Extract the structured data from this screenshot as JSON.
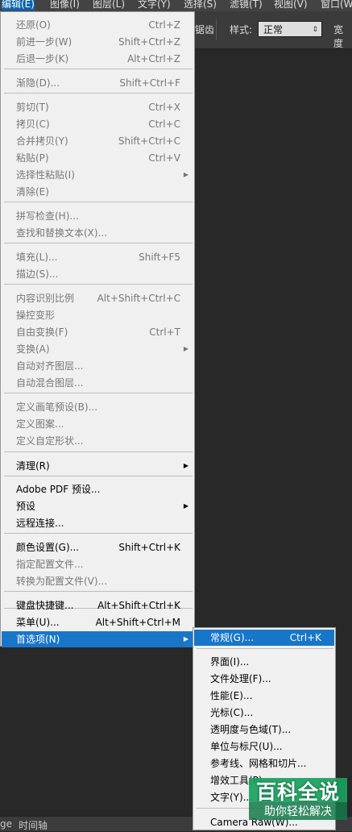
{
  "menubar": {
    "items": [
      "编辑(E)",
      "图像(I)",
      "图层(L)",
      "文字(Y)",
      "选择(S)",
      "滤镜(T)",
      "视图(V)",
      "窗口(W"
    ]
  },
  "options_bar": {
    "partial_label": "锯齿",
    "style_label": "样式:",
    "style_value": "正常",
    "width_label": "宽度"
  },
  "bottom_tabs": [
    "ge",
    "时间轴"
  ],
  "edit_menu": {
    "items": [
      {
        "label": "还原(O)",
        "shortcut": "Ctrl+Z",
        "disabled": true
      },
      {
        "label": "前进一步(W)",
        "shortcut": "Shift+Ctrl+Z",
        "disabled": true
      },
      {
        "label": "后退一步(K)",
        "shortcut": "Alt+Ctrl+Z",
        "disabled": true
      },
      {
        "label": "渐隐(D)...",
        "shortcut": "Shift+Ctrl+F",
        "disabled": true
      },
      {
        "label": "剪切(T)",
        "shortcut": "Ctrl+X",
        "disabled": true
      },
      {
        "label": "拷贝(C)",
        "shortcut": "Ctrl+C",
        "disabled": true
      },
      {
        "label": "合并拷贝(Y)",
        "shortcut": "Shift+Ctrl+C",
        "disabled": true
      },
      {
        "label": "粘贴(P)",
        "shortcut": "Ctrl+V",
        "disabled": true
      },
      {
        "label": "选择性粘贴(I)",
        "shortcut": "",
        "disabled": true,
        "submenu": true
      },
      {
        "label": "清除(E)",
        "shortcut": "",
        "disabled": true
      },
      {
        "label": "拼写检查(H)...",
        "shortcut": "",
        "disabled": true
      },
      {
        "label": "查找和替换文本(X)...",
        "shortcut": "",
        "disabled": true
      },
      {
        "label": "填充(L)...",
        "shortcut": "Shift+F5",
        "disabled": true
      },
      {
        "label": "描边(S)...",
        "shortcut": "",
        "disabled": true
      },
      {
        "label": "内容识别比例",
        "shortcut": "Alt+Shift+Ctrl+C",
        "disabled": true
      },
      {
        "label": "操控变形",
        "shortcut": "",
        "disabled": true
      },
      {
        "label": "自由变换(F)",
        "shortcut": "Ctrl+T",
        "disabled": true
      },
      {
        "label": "变换(A)",
        "shortcut": "",
        "disabled": true,
        "submenu": true
      },
      {
        "label": "自动对齐图层...",
        "shortcut": "",
        "disabled": true
      },
      {
        "label": "自动混合图层...",
        "shortcut": "",
        "disabled": true
      },
      {
        "label": "定义画笔预设(B)...",
        "shortcut": "",
        "disabled": true
      },
      {
        "label": "定义图案...",
        "shortcut": "",
        "disabled": true
      },
      {
        "label": "定义自定形状...",
        "shortcut": "",
        "disabled": true
      },
      {
        "label": "清理(R)",
        "shortcut": "",
        "disabled": false,
        "submenu": true
      },
      {
        "label": "Adobe PDF 预设...",
        "shortcut": "",
        "disabled": false
      },
      {
        "label": "预设",
        "shortcut": "",
        "disabled": false,
        "submenu": true
      },
      {
        "label": "远程连接...",
        "shortcut": "",
        "disabled": false
      },
      {
        "label": "颜色设置(G)...",
        "shortcut": "Shift+Ctrl+K",
        "disabled": false
      },
      {
        "label": "指定配置文件...",
        "shortcut": "",
        "disabled": true
      },
      {
        "label": "转换为配置文件(V)...",
        "shortcut": "",
        "disabled": true
      },
      {
        "label": "键盘快捷键...",
        "shortcut": "Alt+Shift+Ctrl+K",
        "disabled": false
      },
      {
        "label": "菜单(U)...",
        "shortcut": "Alt+Shift+Ctrl+M",
        "disabled": false
      },
      {
        "label": "首选项(N)",
        "shortcut": "",
        "disabled": false,
        "submenu": true,
        "highlighted": true
      }
    ]
  },
  "preferences_submenu": {
    "items": [
      {
        "label": "常规(G)...",
        "shortcut": "Ctrl+K",
        "highlighted": true
      },
      {
        "label": "界面(I)...",
        "shortcut": ""
      },
      {
        "label": "文件处理(F)...",
        "shortcut": ""
      },
      {
        "label": "性能(E)...",
        "shortcut": ""
      },
      {
        "label": "光标(C)...",
        "shortcut": ""
      },
      {
        "label": "透明度与色域(T)...",
        "shortcut": ""
      },
      {
        "label": "单位与标尺(U)...",
        "shortcut": ""
      },
      {
        "label": "参考线、网格和切片...",
        "shortcut": ""
      },
      {
        "label": "增效工具(P)...",
        "shortcut": ""
      },
      {
        "label": "文字(Y)...",
        "shortcut": ""
      },
      {
        "label": "Camera Raw(W)...",
        "shortcut": ""
      }
    ]
  },
  "watermark": {
    "title": "百科全说",
    "subtitle": "助你轻松解决"
  },
  "colors": {
    "menu_bg": "#f0f0f0",
    "highlight": "#1876c9",
    "app_bg": "#282828",
    "watermark_green": "#19a15f"
  }
}
